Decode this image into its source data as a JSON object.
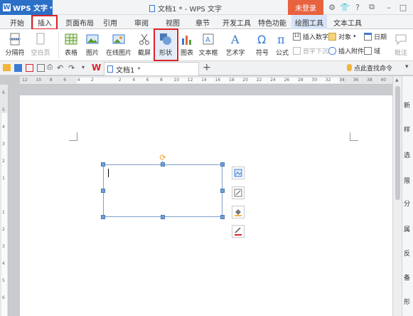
{
  "titlebar": {
    "app_name": "WPS 文字",
    "doc_title": "文档1 * - WPS 文字",
    "login_label": "未登录"
  },
  "tabs": [
    {
      "label": "开始"
    },
    {
      "label": "插入"
    },
    {
      "label": "页面布局"
    },
    {
      "label": "引用"
    },
    {
      "label": "审阅"
    },
    {
      "label": "视图"
    },
    {
      "label": "章节"
    },
    {
      "label": "开发工具"
    },
    {
      "label": "特色功能"
    },
    {
      "label": "绘图工具"
    },
    {
      "label": "文本工具"
    }
  ],
  "ribbon": {
    "page_break": "分隔符",
    "blank_page": "空白页",
    "table": "表格",
    "picture": "图片",
    "online_picture": "在线图片",
    "screenshot": "截屏",
    "shape": "形状",
    "chart": "图表",
    "textbox": "文本框",
    "wordart": "艺术字",
    "symbol": "符号",
    "formula": "公式",
    "insert_number": "插入数字",
    "object": "对象",
    "date": "日期",
    "dropcap": "首字下沉",
    "attachment": "插入附件",
    "field": "域",
    "comment": "批注"
  },
  "quickbar": {
    "doc_tab": "文档1",
    "search_hint": "点此查找命令"
  },
  "ruler_h": [
    "12",
    "10",
    "8",
    "6",
    "4",
    "2",
    "",
    "2",
    "4",
    "6",
    "8",
    "10",
    "12",
    "14",
    "16",
    "18",
    "20",
    "22",
    "24",
    "26",
    "28",
    "30",
    "32",
    "34",
    "36",
    "38",
    "40"
  ],
  "ruler_v": [
    "6",
    "5",
    "4",
    "3",
    "2",
    "1",
    "",
    "1",
    "2",
    "3",
    "4",
    "5",
    "6"
  ],
  "right_panel": [
    "新",
    "样",
    "选",
    "限",
    "分",
    "属",
    "反",
    "备",
    "形"
  ],
  "colors": {
    "accent": "#2b6fc7",
    "login": "#e8623f",
    "highlight": "#d9232a",
    "rotate": "#f29c1f"
  }
}
